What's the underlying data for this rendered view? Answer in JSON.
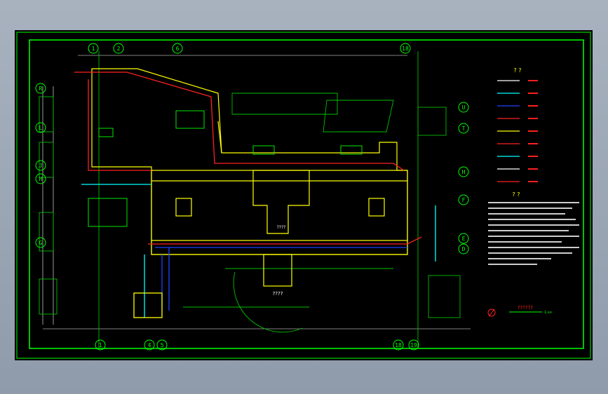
{
  "colors": {
    "background": "#000000",
    "border": "#00ff00",
    "walls": "#ffff00",
    "pipe_red": "#ff2020",
    "pipe_blue": "#2040ff",
    "pipe_cyan": "#00ffff",
    "site_line": "#00c000",
    "text_white": "#ffffff"
  },
  "grid_axes": {
    "top": [
      "1",
      "2",
      "6",
      "18"
    ],
    "bottom": [
      "1",
      "4",
      "5",
      "18",
      "19"
    ],
    "left": [
      "R",
      "L",
      "J",
      "H",
      "G"
    ],
    "right": [
      "U",
      "T",
      "H",
      "F",
      "E",
      "D"
    ]
  },
  "legend": {
    "title": "? ?",
    "row_count": 9
  },
  "notes": {
    "title": "? ?"
  },
  "plan_labels": {
    "main_hall": "????",
    "below_plan": "????"
  },
  "footer": {
    "plan_title": "??????",
    "scale": "1:xx"
  }
}
